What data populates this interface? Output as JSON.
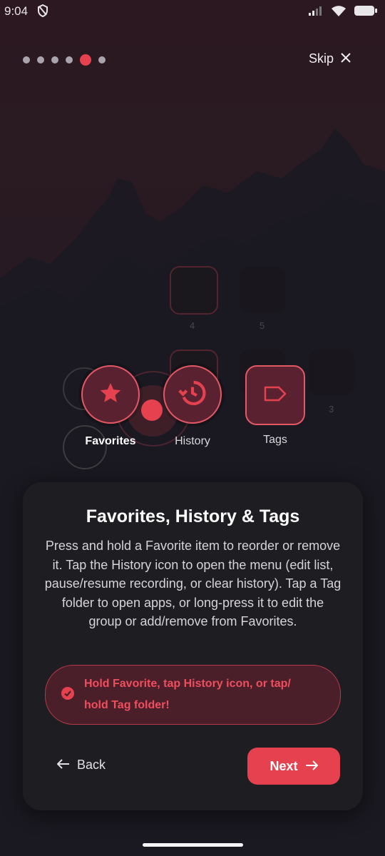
{
  "status": {
    "time": "9:04"
  },
  "onboarding": {
    "steps_total": 6,
    "active_step": 5,
    "skip_label": "Skip"
  },
  "grid": {
    "ghost_numbers": [
      "4",
      "5",
      "3"
    ]
  },
  "features": [
    {
      "label": "Favorites",
      "icon": "star-icon"
    },
    {
      "label": "History",
      "icon": "history-icon"
    },
    {
      "label": "Tags",
      "icon": "tag-icon"
    }
  ],
  "card": {
    "title": "Favorites, History & Tags",
    "body": "Press and hold a Favorite item to reorder or remove it. Tap the History icon to open the menu (edit list, pause/resume recording, or clear history). Tap a Tag folder to open apps, or long-press it to edit the group or add/remove from Favorites.",
    "hint": "Hold Favorite, tap History icon, or tap/ hold Tag folder!",
    "back_label": "Back",
    "next_label": "Next"
  },
  "colors": {
    "accent": "#e6414f",
    "card_bg": "#1e1d22",
    "hint_bg": "#4a1f2a"
  }
}
